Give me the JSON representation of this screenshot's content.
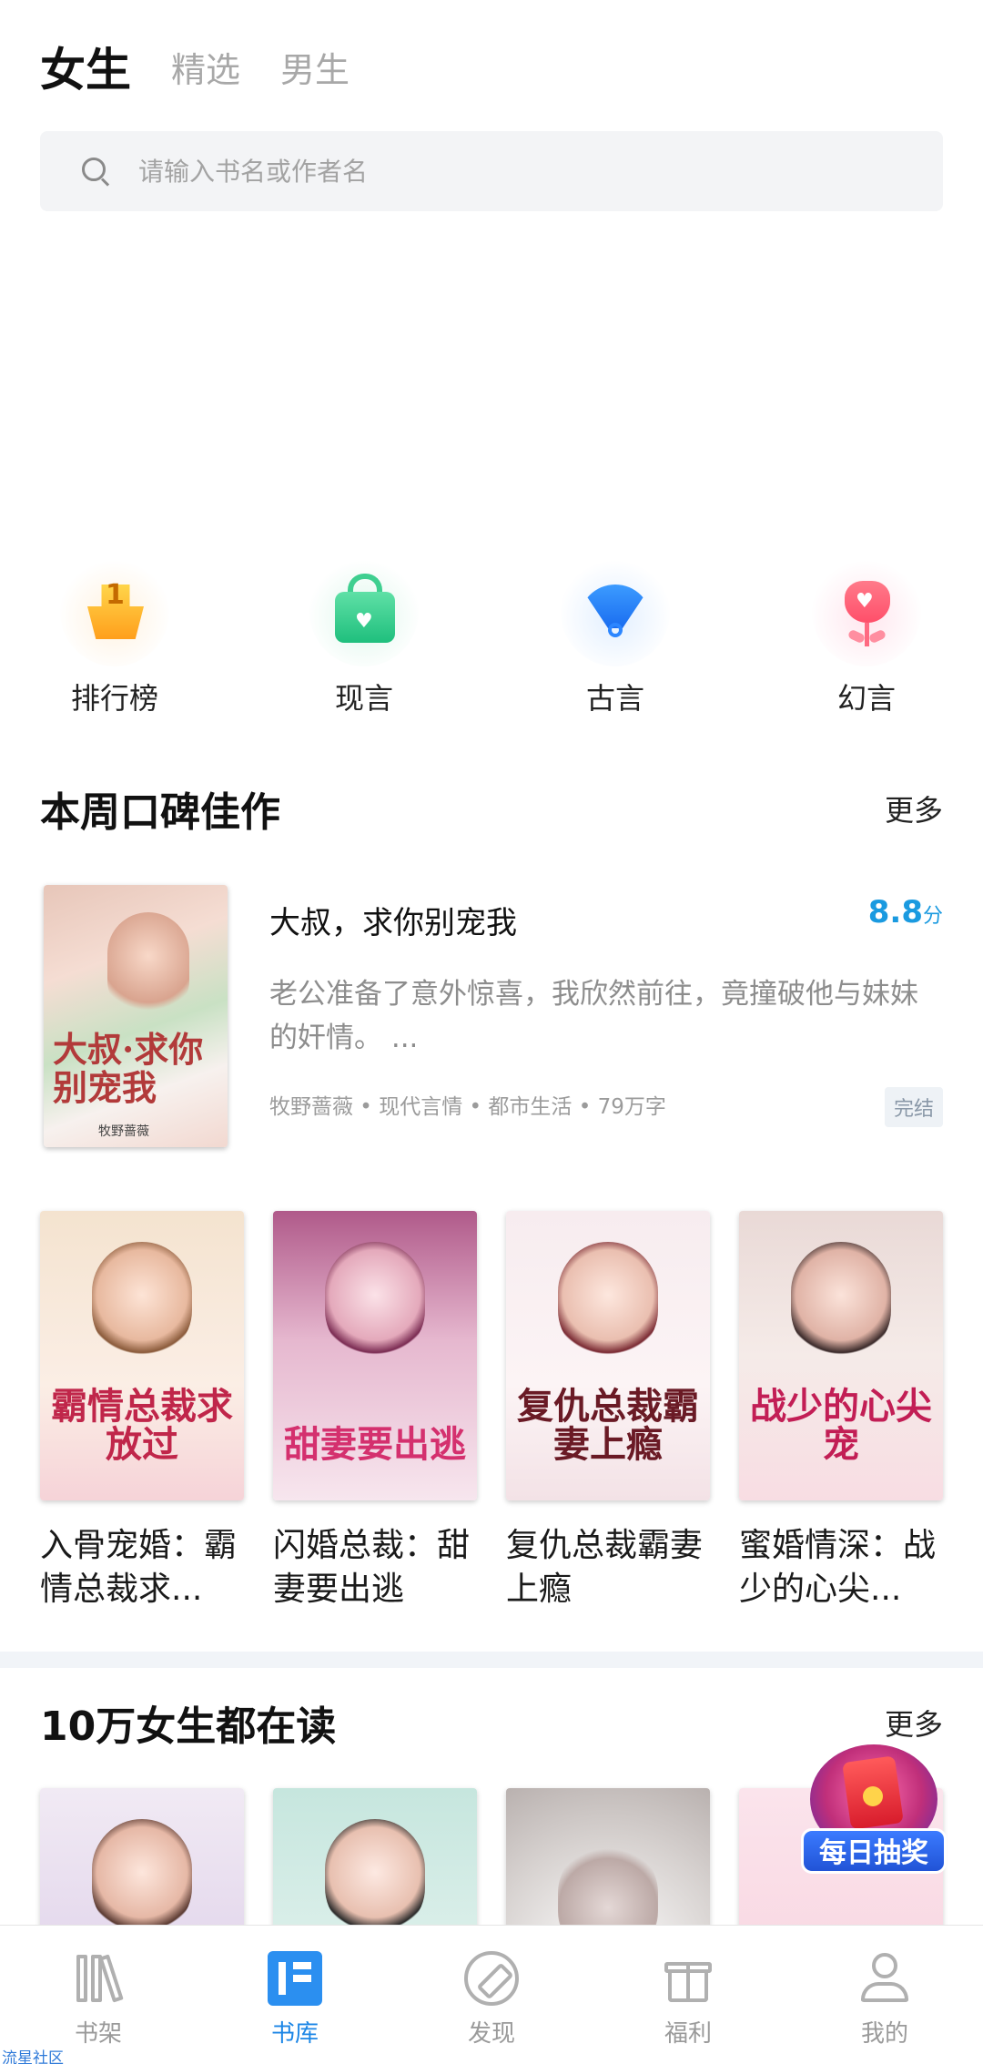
{
  "top_tabs": [
    {
      "label": "女生",
      "active": true
    },
    {
      "label": "精选",
      "active": false
    },
    {
      "label": "男生",
      "active": false
    }
  ],
  "search": {
    "placeholder": "请输入书名或作者名",
    "icon": "search-icon"
  },
  "categories": [
    {
      "label": "排行榜",
      "icon": "ranking-trophy-icon",
      "badge": "1"
    },
    {
      "label": "现言",
      "icon": "handbag-icon"
    },
    {
      "label": "古言",
      "icon": "folding-fan-icon"
    },
    {
      "label": "幻言",
      "icon": "rose-flower-icon"
    }
  ],
  "section1": {
    "title": "本周口碑佳作",
    "more": "更多",
    "featured": {
      "title": "大叔，求你别宠我",
      "score": "8.8",
      "score_unit": "分",
      "description": "老公准备了意外惊喜，我欣然前往，竟撞破他与妹妹的奸情。 ...",
      "meta": "牧野蔷薇 • 现代言情 • 都市生活 • 79万字",
      "status": "完结",
      "cover_text": "大叔·求你别宠我",
      "cover_author": "牧野蔷薇"
    },
    "books": [
      {
        "title": "入骨宠婚：霸情总裁求...",
        "cover_text": "霸情总裁求放过"
      },
      {
        "title": "闪婚总裁：甜妻要出逃",
        "cover_text": "甜妻要出逃"
      },
      {
        "title": "复仇总裁霸妻上瘾",
        "cover_text": "复仇总裁霸妻上瘾"
      },
      {
        "title": "蜜婚情深：战少的心尖...",
        "cover_text": "战少的心尖宠"
      }
    ]
  },
  "section2": {
    "title": "10万女生都在读",
    "more": "更多"
  },
  "lottery": {
    "label": "每日抽奖",
    "icon": "red-envelope-icon"
  },
  "tabbar": [
    {
      "label": "书架",
      "icon": "bookshelf-icon",
      "active": false
    },
    {
      "label": "书库",
      "icon": "library-icon",
      "active": true
    },
    {
      "label": "发现",
      "icon": "compass-icon",
      "active": false
    },
    {
      "label": "福利",
      "icon": "gift-icon",
      "active": false
    },
    {
      "label": "我的",
      "icon": "profile-icon",
      "active": false
    }
  ],
  "community_link": "流星社区",
  "colors": {
    "accent": "#1c86e6",
    "score": "#1a9ae0",
    "muted": "#9a9a9a"
  }
}
